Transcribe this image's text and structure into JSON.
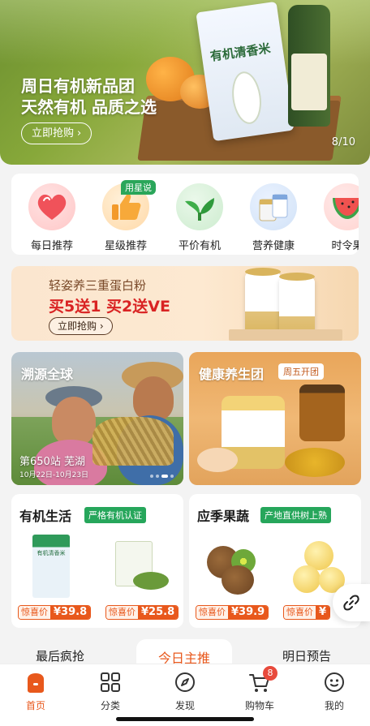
{
  "hero": {
    "line1": "周日有机新品团",
    "line2": "天然有机 品质之选",
    "button": "立即抢购",
    "counter": "8/10",
    "product_text": "有机清香米"
  },
  "categories": [
    {
      "label": "每日推荐",
      "icon": "heart-icon"
    },
    {
      "label": "星级推荐",
      "icon": "thumbs-up-icon",
      "tag": "用星说"
    },
    {
      "label": "平价有机",
      "icon": "leaf-icon"
    },
    {
      "label": "营养健康",
      "icon": "milk-powder-icon"
    },
    {
      "label": "时令果",
      "icon": "watermelon-icon"
    }
  ],
  "promo": {
    "line1": "轻姿养三重蛋白粉",
    "line2": "买5送1  买2送VE",
    "button": "立即抢购"
  },
  "tiles": {
    "left": {
      "title": "溯源全球",
      "station": "第650站 芜湖",
      "dates": "10月22日-10月23日"
    },
    "right": {
      "title": "健康养生团",
      "chip": "周五开团"
    }
  },
  "products": {
    "left": {
      "title": "有机生活",
      "badge": "严格有机认证",
      "items": [
        {
          "label": "惊喜价",
          "price": "¥39.8",
          "pack_text": "有机清香米"
        },
        {
          "label": "惊喜价",
          "price": "¥25.8"
        }
      ]
    },
    "right": {
      "title": "应季果蔬",
      "badge": "产地直供树上熟",
      "items": [
        {
          "label": "惊喜价",
          "price": "¥39.9"
        },
        {
          "label": "惊喜价",
          "price": "¥"
        }
      ]
    }
  },
  "section_tabs": [
    "最后疯抢",
    "今日主推",
    "明日预告"
  ],
  "nav": [
    {
      "label": "首页",
      "icon": "home-icon"
    },
    {
      "label": "分类",
      "icon": "grid-icon"
    },
    {
      "label": "发现",
      "icon": "compass-icon"
    },
    {
      "label": "购物车",
      "icon": "cart-icon",
      "badge": "8"
    },
    {
      "label": "我的",
      "icon": "profile-icon"
    }
  ],
  "colors": {
    "accent": "#e8581c",
    "green": "#26a65b",
    "promo_red": "#d92323"
  }
}
